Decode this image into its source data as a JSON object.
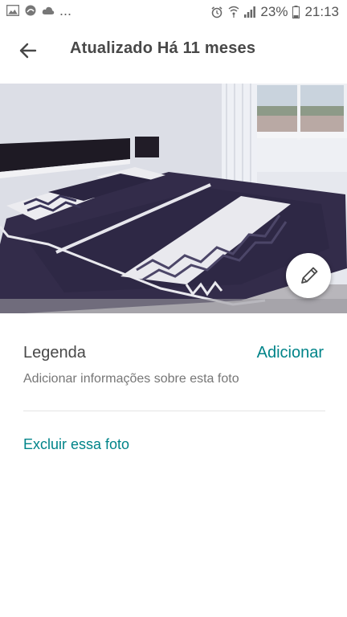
{
  "status_bar": {
    "battery": "23%",
    "time": "21:13",
    "overflow": "..."
  },
  "header": {
    "title": "Atualizado Há 11 meses"
  },
  "caption": {
    "label": "Legenda",
    "add_label": "Adicionar",
    "hint": "Adicionar informações sobre esta foto"
  },
  "actions": {
    "delete_label": "Excluir essa foto"
  },
  "colors": {
    "accent": "#008489",
    "text": "#484848",
    "muted": "#767676"
  }
}
